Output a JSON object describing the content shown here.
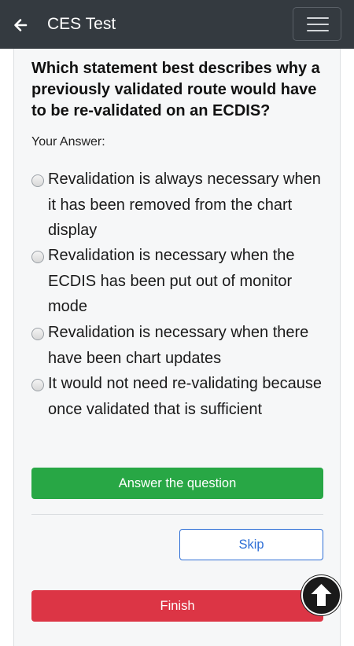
{
  "header": {
    "title": "CES Test",
    "back_icon": "arrow-left-icon",
    "menu_icon": "hamburger-menu-icon",
    "background": "#343a40"
  },
  "question": {
    "text": "Which statement best describes why a previously validated route would have to be re-validated on an ECDIS?",
    "answer_label": "Your Answer:",
    "options": [
      "Revalidation is always necessary when it has been removed from the chart display",
      "Revalidation is necessary when the ECDIS has been put out of monitor mode",
      "Revalidation is necessary when there have been chart updates",
      "It would not need re-validating because once validated that is sufficient"
    ]
  },
  "actions": {
    "answer_label": "Answer the question",
    "skip_label": "Skip",
    "finish_label": "Finish",
    "answer_color": "#28a745",
    "skip_color": "#2f6fd6",
    "finish_color": "#dc3545"
  },
  "scroll_top": {
    "icon": "arrow-up-circle-icon"
  }
}
